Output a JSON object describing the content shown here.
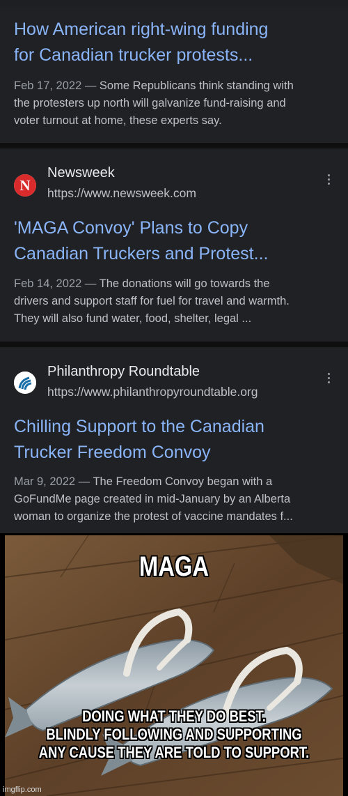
{
  "results": [
    {
      "title_lines": [
        "How American right-wing funding",
        "for Canadian trucker protests..."
      ],
      "date": "Feb 17, 2022",
      "dash": " — ",
      "snippet_lines": [
        "Some Republicans think standing with",
        "the protesters up north will galvanize fund-raising and",
        "voter turnout at home, these experts say."
      ]
    },
    {
      "source_name": "Newsweek",
      "source_url": "https://www.newsweek.com",
      "logo_letter": "N",
      "title_lines": [
        "'MAGA Convoy' Plans to Copy",
        "Canadian Truckers and Protest..."
      ],
      "date": "Feb 14, 2022",
      "dash": " — ",
      "snippet_lines": [
        "The donations will go towards the",
        "drivers and support staff for fuel for travel and warmth.",
        "They will also fund water, food, shelter, legal ..."
      ]
    },
    {
      "source_name": "Philanthropy Roundtable",
      "source_url": "https://www.philanthropyroundtable.org",
      "title_lines": [
        "Chilling Support to the Canadian",
        "Trucker Freedom Convoy"
      ],
      "date": "Mar 9, 2022",
      "dash": " — ",
      "snippet_lines": [
        "The Freedom Convoy began with a",
        "GoFundMe page created in mid-January by an Alberta",
        "woman to organize the protest of vaccine mandates f..."
      ]
    }
  ],
  "meme": {
    "top_text": "MAGA",
    "bottom_lines": [
      "DOING WHAT THEY DO BEST.",
      "BLINDLY FOLLOWING AND SUPPORTING",
      "ANY CAUSE THEY ARE TOLD TO SUPPORT."
    ]
  },
  "watermark": "imgflip.com",
  "colors": {
    "link_blue": "#8ab4f8",
    "card_bg": "#202124",
    "newsweek_red": "#d92b2b"
  },
  "icons": {
    "more": "kebab-menu-icon",
    "newsweek": "newsweek-logo-icon",
    "philanthropy": "philanthropy-roundtable-logo-icon"
  }
}
